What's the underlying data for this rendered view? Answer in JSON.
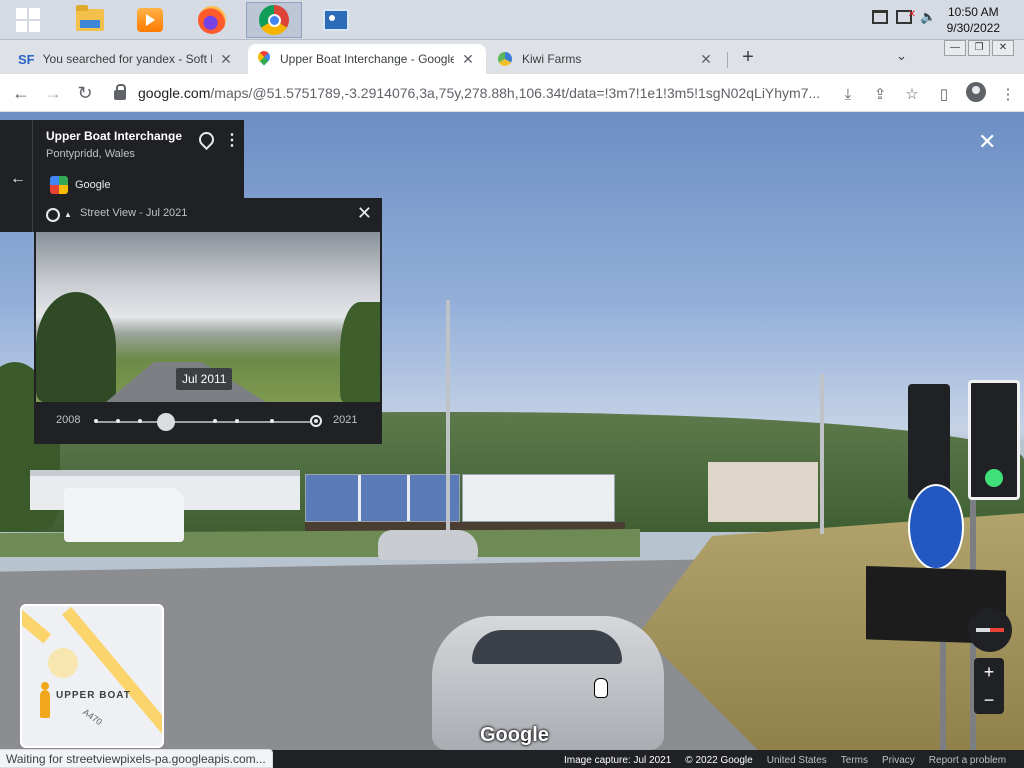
{
  "taskbar": {
    "apps": [
      {
        "name": "windows-start",
        "icon": "windows-logo-icon"
      },
      {
        "name": "file-explorer",
        "icon": "folder-icon"
      },
      {
        "name": "media-player",
        "icon": "media-player-icon"
      },
      {
        "name": "firefox",
        "icon": "firefox-icon"
      },
      {
        "name": "chrome",
        "icon": "chrome-icon",
        "active": true
      },
      {
        "name": "control-panel",
        "icon": "control-panel-icon"
      }
    ],
    "time": "10:50 AM",
    "date": "9/30/2022"
  },
  "browser": {
    "tabs": [
      {
        "favicon": "SF",
        "title": "You searched for yandex - Soft F",
        "close": "✕"
      },
      {
        "title": "Upper Boat Interchange - Google",
        "close": "✕",
        "active": true
      },
      {
        "title": "Kiwi Farms",
        "close": "✕"
      }
    ],
    "new_tab": "+",
    "tab_search": "⌄",
    "window_controls": {
      "minimize": "—",
      "restore": "❐",
      "close": "✕"
    },
    "nav": {
      "back": "←",
      "forward": "→",
      "reload": "↻"
    },
    "url": {
      "host": "google.com",
      "path": "/maps/@51.5751789,-3.2914076,3a,75y,278.88h,106.34t/data=!3m7!1e1!3m5!1sgN02qLiYhym7..."
    }
  },
  "place_card": {
    "back": "←",
    "name": "Upper Boat Interchange",
    "subtitle": "Pontypridd, Wales",
    "more": "⋮",
    "provider": "Google"
  },
  "time_machine": {
    "title": "Street View - Jul 2021",
    "close": "✕",
    "preview_date": "Jul 2011",
    "zoom": "🔍",
    "start_year": "2008",
    "end_year": "2021",
    "selected_fraction": 0.32
  },
  "street_view": {
    "close": "✕",
    "logo": "Google"
  },
  "minimap": {
    "place_label": "UPPER BOAT",
    "road_label": "A470"
  },
  "controls": {
    "zoom_in": "+",
    "zoom_out": "−"
  },
  "footer": {
    "capture": "Image capture: Jul 2021",
    "copyright": "© 2022 Google",
    "country": "United States",
    "terms": "Terms",
    "privacy": "Privacy",
    "report": "Report a problem"
  },
  "status": "Waiting for streetviewpixels-pa.googleapis.com..."
}
